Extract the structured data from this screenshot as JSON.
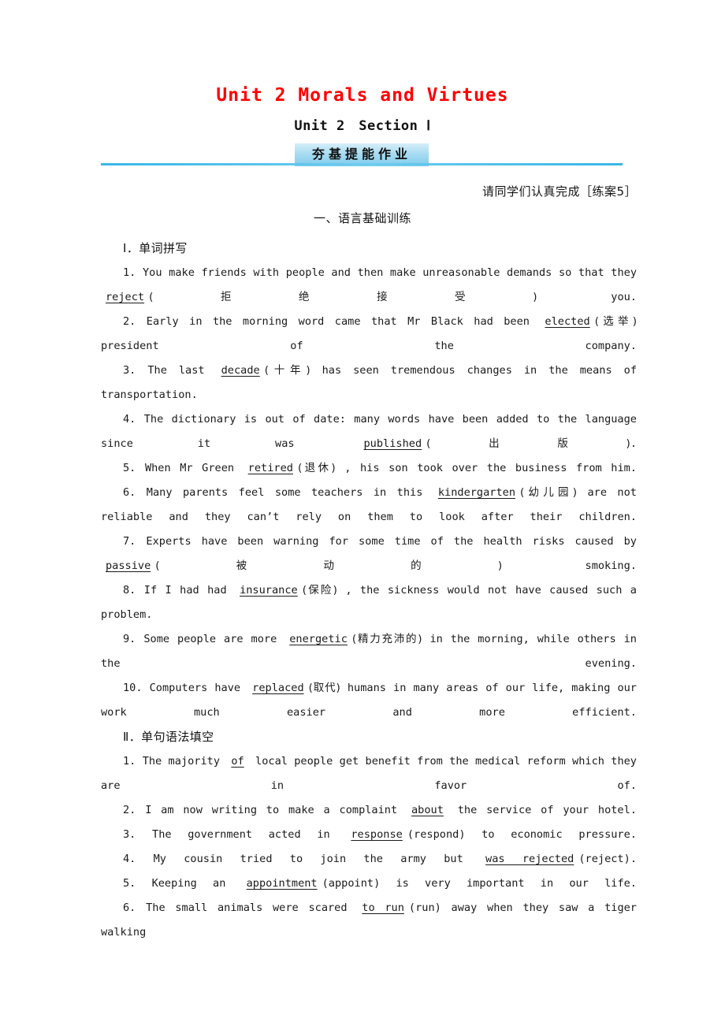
{
  "header": {
    "unit_title": "Unit 2 Morals and Virtues",
    "section_title": "Unit 2　Section Ⅰ",
    "badge_label": "夯基提能作业",
    "note": "请同学们认真完成［练案5］",
    "part_heading": "一、语言基础训练",
    "accent_red": "#ff0000",
    "accent_blue": "#39b6e8",
    "badge_bg_top": "#d5eef8",
    "badge_bg_bottom": "#7fccec"
  },
  "sections": [
    {
      "id": "part-1",
      "heading": "Ⅰ．单词拼写",
      "items": [
        {
          "num": "1.",
          "pre": "You make friends with people and then make unreasonable demands so that they",
          "blank": "reject",
          "hint": "(拒绝接受)",
          "post": "you."
        },
        {
          "num": "2.",
          "pre": "Early in the morning word came that Mr Black had been",
          "blank": "elected",
          "hint": "(选举)",
          "post": "president of the company."
        },
        {
          "num": "3.",
          "pre": "The last",
          "blank": "decade",
          "hint": "(十年)",
          "post": "has seen tremendous changes in the means of transportation."
        },
        {
          "num": "4.",
          "pre": "The dictionary is out of date: many words have been added to the language since it was",
          "blank": "published",
          "hint": "(出版)",
          "post": "."
        },
        {
          "num": "5.",
          "pre": "When Mr Green",
          "blank": "retired",
          "hint": "(退休)",
          "post": ", his son took over the business from him."
        },
        {
          "num": "6.",
          "pre": "Many parents feel some teachers in this",
          "blank": "kindergarten",
          "hint": "(幼儿园)",
          "post": "are not reliable and they can’t rely on them to look after their children."
        },
        {
          "num": "7.",
          "pre": "Experts have been warning for some time of the health risks caused by",
          "blank": "passive",
          "hint": "(被动的)",
          "post": "smoking."
        },
        {
          "num": "8.",
          "pre": "If I had had",
          "blank": "insurance",
          "hint": "(保险)",
          "post": ", the sickness would not have caused such a problem."
        },
        {
          "num": "9.",
          "pre": "Some people are more",
          "blank": "energetic",
          "hint": "(精力充沛的)",
          "post": "in the morning, while others in the evening."
        },
        {
          "num": "10.",
          "pre": "Computers have",
          "blank": "replaced",
          "hint": "(取代)",
          "post": "humans in many areas of our life, making our work much easier and more efficient."
        }
      ]
    },
    {
      "id": "part-2",
      "heading": "Ⅱ．单句语法填空",
      "items": [
        {
          "num": "1.",
          "pre": "The majority",
          "blank": "of",
          "hint": "",
          "post": "local people get benefit from the medical reform which they are in favor of."
        },
        {
          "num": "2.",
          "pre": "I am now writing to make a complaint",
          "blank": "about",
          "hint": "",
          "post": "the service of your hotel."
        },
        {
          "num": "3.",
          "pre": "The government acted in",
          "blank": "response",
          "hint": "(respond)",
          "post": "to economic pressure."
        },
        {
          "num": "4.",
          "pre": "My cousin tried to join the army but",
          "blank": "was rejected",
          "hint": "(reject)",
          "post": "."
        },
        {
          "num": "5.",
          "pre": "Keeping an",
          "blank": "appointment",
          "hint": "(appoint)",
          "post": "is very important in our life."
        },
        {
          "num": "6.",
          "pre": "The small animals were scared",
          "blank": "to run",
          "hint": "(run)",
          "post": "away when they saw a tiger walking"
        }
      ]
    }
  ]
}
